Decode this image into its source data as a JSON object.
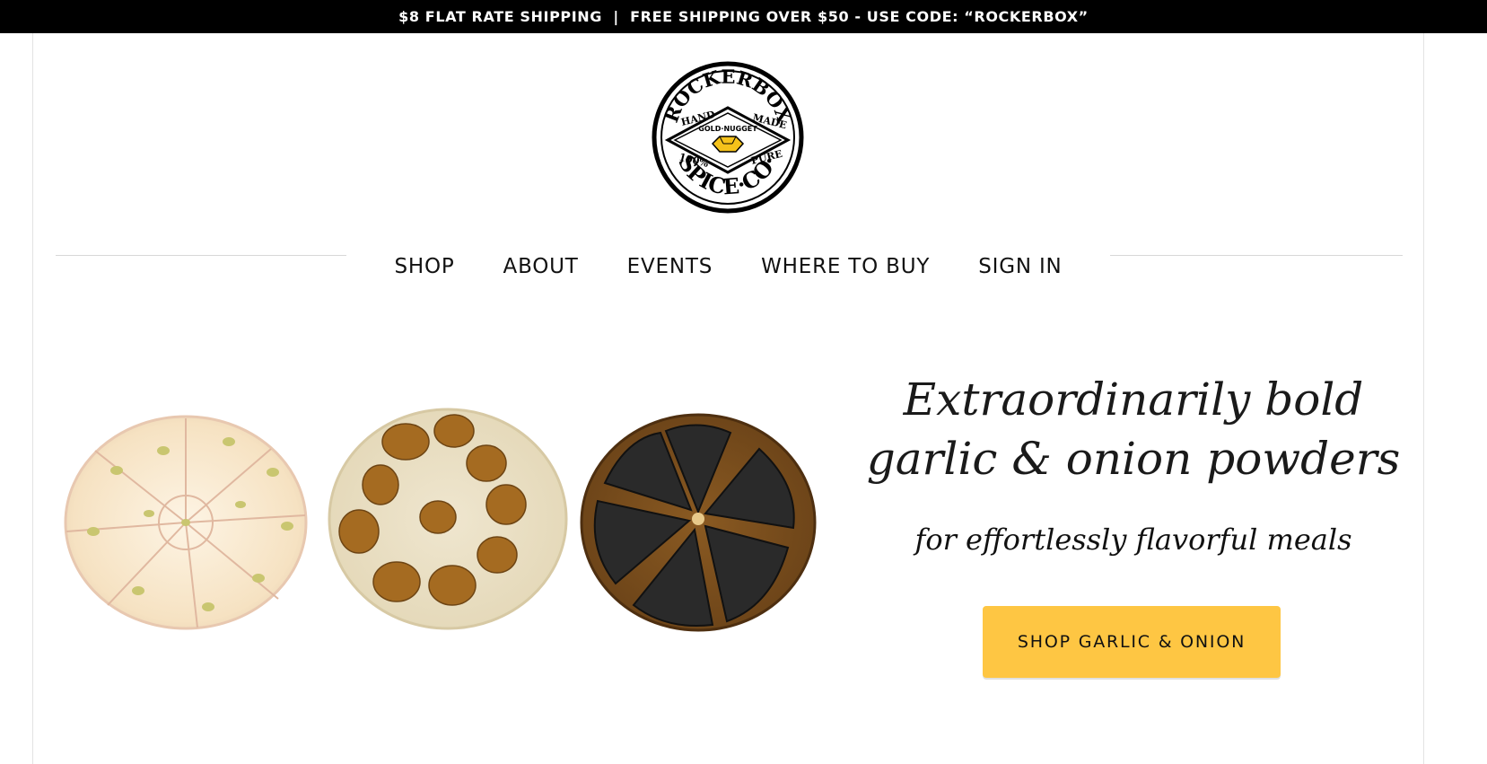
{
  "announcement": {
    "text": "$8 FLAT RATE SHIPPING  |  FREE SHIPPING OVER $50 - USE CODE: “ROCKERBOX”"
  },
  "logo": {
    "top_text": "ROCKERBOX",
    "left_upper": "HAND",
    "right_upper": "MADE",
    "left_lower": "100%",
    "right_lower": "PURE",
    "center_text": "GOLD·NUGGET",
    "bottom_text": "SPICE·CO·",
    "gold_color": "#f5c21b"
  },
  "nav": {
    "items": [
      {
        "label": "SHOP"
      },
      {
        "label": "ABOUT"
      },
      {
        "label": "EVENTS"
      },
      {
        "label": "WHERE TO BUY"
      },
      {
        "label": "SIGN IN"
      }
    ]
  },
  "hero": {
    "headline_line1": "Extraordinarily bold",
    "headline_line2": "garlic & onion powders",
    "subhead": "for effortlessly flavorful meals",
    "cta_label": "SHOP GARLIC & ONION",
    "cta_color": "#fec643",
    "images": [
      "raw-garlic-bulb",
      "roasted-garlic-bulb",
      "black-garlic-bulb"
    ]
  }
}
